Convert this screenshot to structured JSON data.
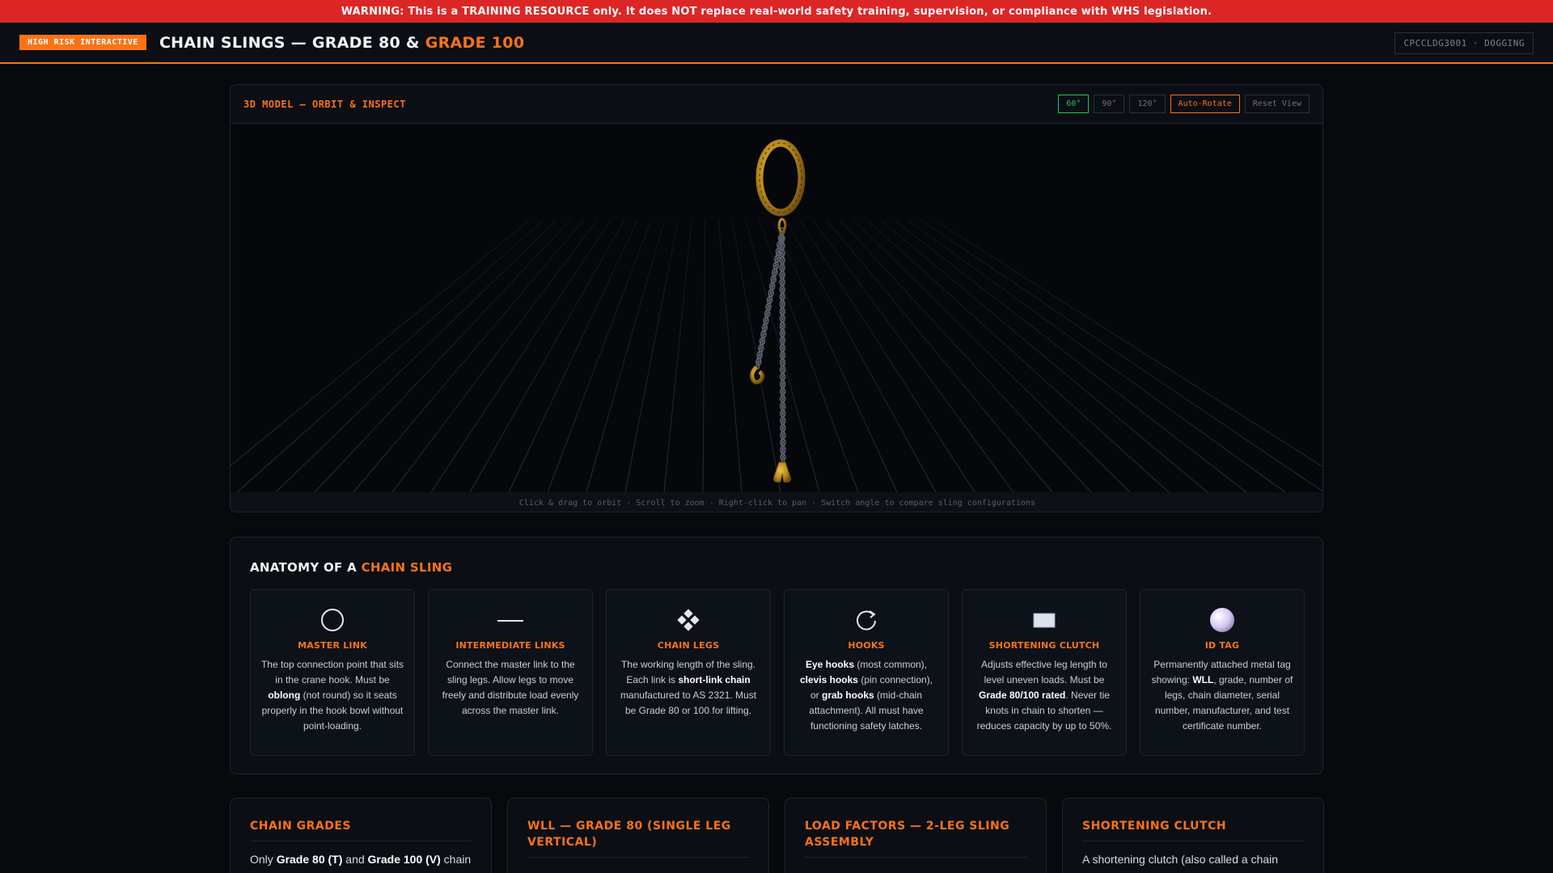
{
  "warning": "WARNING: This is a TRAINING RESOURCE only. It does NOT replace real-world safety training, supervision, or compliance with WHS legislation.",
  "header": {
    "badge": "HIGH RISK INTERACTIVE",
    "title_main": "CHAIN SLINGS — GRADE 80 & ",
    "title_accent": "GRADE 100",
    "course_code": "CPCCLDG3001 · DOGGING"
  },
  "model": {
    "title": "3D MODEL — ORBIT & INSPECT",
    "angle_buttons": [
      "60°",
      "90°",
      "120°"
    ],
    "auto_rotate": "Auto-Rotate",
    "reset_view": "Reset View",
    "hint": "Click & drag to orbit · Scroll to zoom · Right-click to pan · Switch angle to compare sling configurations"
  },
  "anatomy": {
    "title_main": "ANATOMY OF A ",
    "title_accent": "CHAIN SLING",
    "cards": [
      {
        "icon": "master-link-icon",
        "title": "MASTER LINK",
        "html": "The top connection point that sits in the crane hook. Must be <b>oblong</b> (not round) so it seats properly in the hook bowl without point-loading."
      },
      {
        "icon": "intermediate-link-icon",
        "title": "INTERMEDIATE LINKS",
        "html": "Connect the master link to the sling legs. Allow legs to move freely and distribute load evenly across the master link."
      },
      {
        "icon": "chain-legs-icon",
        "title": "CHAIN LEGS",
        "html": "The working length of the sling. Each link is <b>short-link chain</b> manufactured to AS 2321. Must be Grade 80 or 100 for lifting."
      },
      {
        "icon": "hooks-icon",
        "title": "HOOKS",
        "html": "<b>Eye hooks</b> (most common), <b>clevis hooks</b> (pin connection), or <b>grab hooks</b> (mid-chain attachment). All must have functioning safety latches."
      },
      {
        "icon": "shortening-clutch-icon",
        "title": "SHORTENING CLUTCH",
        "html": "Adjusts effective leg length to level uneven loads. Must be <b>Grade 80/100 rated</b>. Never tie knots in chain to shorten — reduces capacity by up to 50%."
      },
      {
        "icon": "id-tag-icon",
        "title": "ID TAG",
        "html": "Permanently attached metal tag showing: <b>WLL</b>, grade, number of legs, chain diameter, serial number, manufacturer, and test certificate number."
      }
    ]
  },
  "bottom_cards": [
    {
      "title": "CHAIN GRADES",
      "text_html": "Only <b>Grade 80 (T)</b> and <b>Grade 100 (V)</b> chain"
    },
    {
      "title": "WLL — GRADE 80 (SINGLE LEG VERTICAL)",
      "text_html": ""
    },
    {
      "title": "LOAD FACTORS — 2-LEG SLING ASSEMBLY",
      "text_html": ""
    },
    {
      "title": "SHORTENING CLUTCH",
      "text_html": "A shortening clutch (also called a chain"
    }
  ]
}
